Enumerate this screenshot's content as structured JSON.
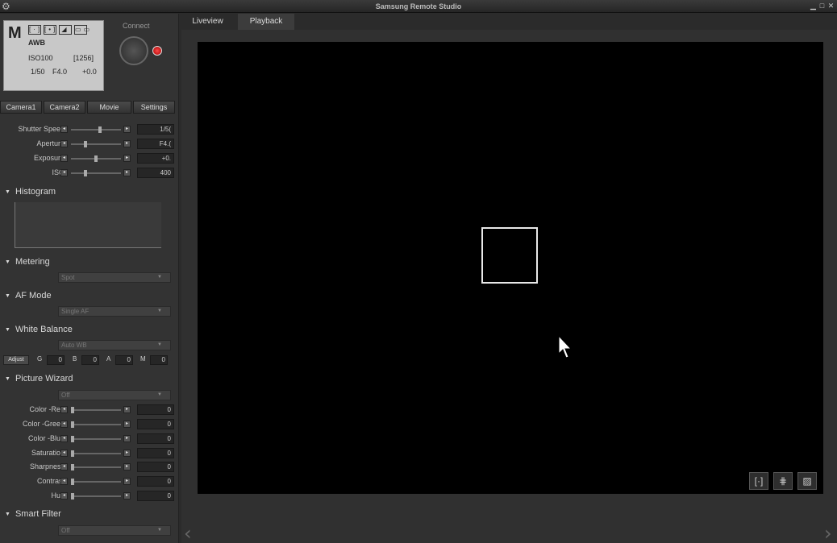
{
  "window": {
    "title": "Samsung Remote Studio",
    "gear_icon": "gear-icon",
    "minimize": "▁",
    "maximize": "□",
    "close": "✕"
  },
  "status": {
    "mode": "M",
    "icons": [
      "[·]",
      "[•]",
      "◢",
      "▭▭"
    ],
    "white_balance": "AWB",
    "iso": "ISO100",
    "shots_remaining": "[1256]",
    "shutter": "1/50",
    "aperture": "F4.0",
    "exposure": "+0.0"
  },
  "connect": {
    "label": "Connect"
  },
  "camera_tabs": [
    "Camera1",
    "Camera2",
    "Movie",
    "Settings"
  ],
  "exposure_controls": [
    {
      "label": "Shutter Speed",
      "value": "1/5("
    },
    {
      "label": "Aperture",
      "value": "F4.("
    },
    {
      "label": "Exposure",
      "value": "+0."
    },
    {
      "label": "ISO",
      "value": "400"
    }
  ],
  "sections": {
    "histogram": "Histogram",
    "metering": "Metering",
    "metering_value": "Spot",
    "af_mode": "AF Mode",
    "af_mode_value": "Single AF",
    "white_balance": "White Balance",
    "white_balance_value": "Auto WB",
    "picture_wizard": "Picture Wizard",
    "picture_wizard_value": "Off",
    "smart_filter": "Smart Filter",
    "smart_filter_value": "Off"
  },
  "wb_adjust": {
    "label": "Adjust",
    "fields": [
      {
        "key": "G",
        "value": "0"
      },
      {
        "key": "B",
        "value": "0"
      },
      {
        "key": "A",
        "value": "0"
      },
      {
        "key": "M",
        "value": "0"
      }
    ]
  },
  "picture_controls": [
    {
      "label": "Color -Red",
      "value": "0"
    },
    {
      "label": "Color -Green",
      "value": "0"
    },
    {
      "label": "Color -Blue",
      "value": "0"
    },
    {
      "label": "Saturation",
      "value": "0"
    },
    {
      "label": "Sharpness",
      "value": "0"
    },
    {
      "label": "Contrast",
      "value": "0"
    },
    {
      "label": "Hue",
      "value": "0"
    }
  ],
  "main_tabs": [
    "Liveview",
    "Playback"
  ],
  "viewer_buttons": [
    "[·]",
    "⋕",
    "▨"
  ],
  "nav": {
    "prev": "‹",
    "next": "›"
  }
}
